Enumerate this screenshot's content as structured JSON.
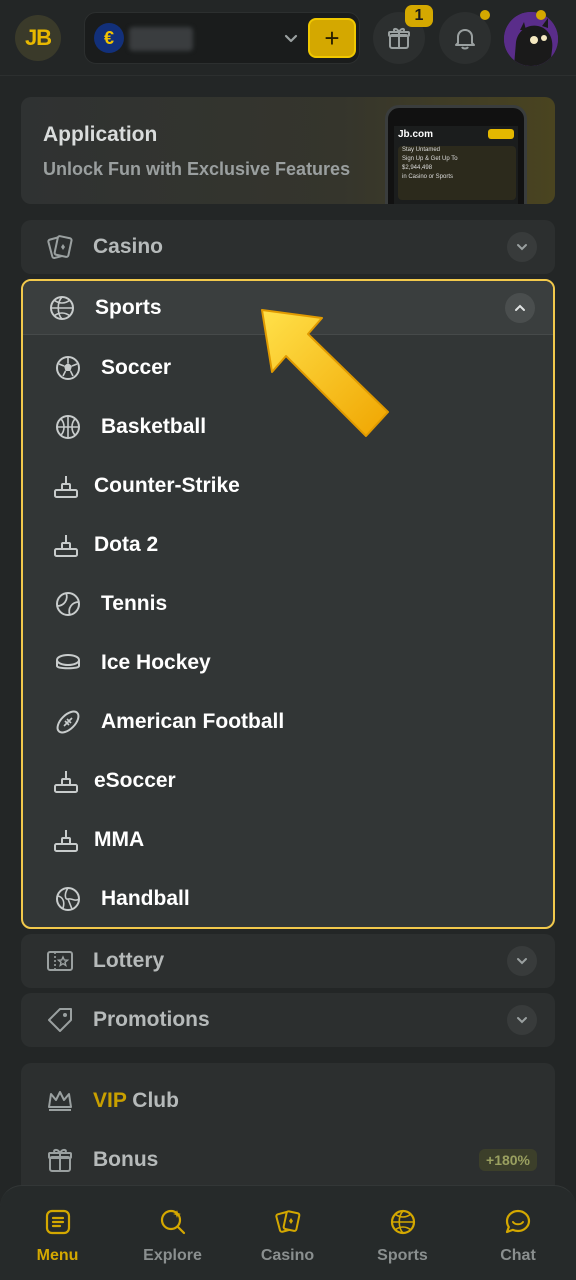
{
  "header": {
    "logo_text": "JB",
    "currency_symbol": "€",
    "deposit_symbol": "+",
    "gift_count": "1"
  },
  "app_banner": {
    "title": "Application",
    "subtitle": "Unlock Fun with Exclusive Features",
    "phone_logo": "Jb.com",
    "phone_promo_lines": [
      "Stay Untamed",
      "Sign Up & Get Up To",
      "$2,944,498",
      "in Casino or Sports"
    ]
  },
  "menu": {
    "casino": "Casino",
    "sports": "Sports",
    "sports_items": [
      {
        "label": "Soccer",
        "icon": "soccer-ball-icon"
      },
      {
        "label": "Basketball",
        "icon": "basketball-icon"
      },
      {
        "label": "Counter-Strike",
        "icon": "joystick-icon"
      },
      {
        "label": "Dota 2",
        "icon": "joystick-icon"
      },
      {
        "label": "Tennis",
        "icon": "tennis-ball-icon"
      },
      {
        "label": "Ice Hockey",
        "icon": "hockey-puck-icon"
      },
      {
        "label": "American Football",
        "icon": "american-football-icon"
      },
      {
        "label": "eSoccer",
        "icon": "joystick-icon"
      },
      {
        "label": "MMA",
        "icon": "joystick-icon"
      },
      {
        "label": "Handball",
        "icon": "handball-icon"
      }
    ],
    "lottery": "Lottery",
    "promotions": "Promotions",
    "vip_part1": "VIP",
    "vip_part2": " Club",
    "bonus": "Bonus",
    "bonus_badge": "+180%"
  },
  "bottom_nav": [
    {
      "label": "Menu",
      "icon": "menu-icon",
      "active": true
    },
    {
      "label": "Explore",
      "icon": "explore-icon",
      "active": false
    },
    {
      "label": "Casino",
      "icon": "casino-cards-icon",
      "active": false
    },
    {
      "label": "Sports",
      "icon": "basketball-icon",
      "active": false
    },
    {
      "label": "Chat",
      "icon": "chat-icon",
      "active": false
    }
  ],
  "colors": {
    "accent": "#d4a800",
    "highlight_border": "#f2c94c",
    "background": "#232626"
  }
}
